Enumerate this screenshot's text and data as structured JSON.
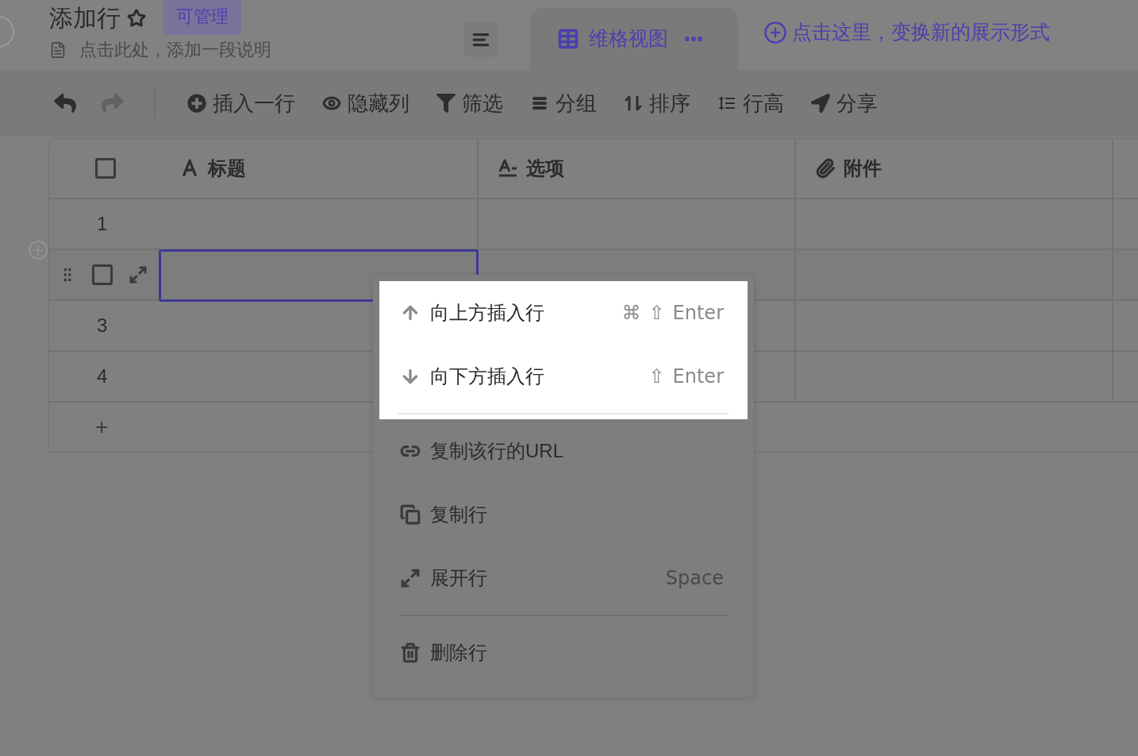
{
  "header": {
    "title": "添加行",
    "starred": false,
    "badge": "可管理",
    "description": "点击此处，添加一段说明"
  },
  "view_tabs": [
    {
      "label": "维格视图",
      "selected": true
    }
  ],
  "add_view_link": "点击这里，变换新的展示形式",
  "toolbar": {
    "undo_disabled": false,
    "redo_disabled": true,
    "buttons": [
      {
        "kind": "insert",
        "label": "插入一行"
      },
      {
        "kind": "hide",
        "label": "隐藏列"
      },
      {
        "kind": "filter",
        "label": "筛选"
      },
      {
        "kind": "group",
        "label": "分组"
      },
      {
        "kind": "sort",
        "label": "排序"
      },
      {
        "kind": "row_height",
        "label": "行高"
      },
      {
        "kind": "share",
        "label": "分享"
      }
    ]
  },
  "table": {
    "header_checked": false,
    "columns": [
      {
        "kind": "text",
        "name": "标题"
      },
      {
        "kind": "option",
        "name": "选项"
      },
      {
        "kind": "attachment",
        "name": "附件"
      }
    ],
    "rows": [
      {
        "number": "1",
        "hovered": false,
        "editing": false
      },
      {
        "hovered": true,
        "editing": true,
        "checked": false
      },
      {
        "number": "3",
        "hovered": false,
        "editing": false
      },
      {
        "number": "4",
        "hovered": false,
        "editing": false
      }
    ],
    "add_row": "+"
  },
  "context_menu": {
    "items": [
      {
        "kind": "insert_above",
        "label": "向上方插入行",
        "shortcut": [
          "⌘",
          "⇧",
          "Enter"
        ],
        "highlighted": true
      },
      {
        "kind": "insert_below",
        "label": "向下方插入行",
        "shortcut": [
          "⇧",
          "Enter"
        ],
        "highlighted": true
      },
      {
        "kind": "divider",
        "highlighted": true
      },
      {
        "kind": "copy_url",
        "label": "复制该行的URL",
        "highlighted": false
      },
      {
        "kind": "duplicate",
        "label": "复制行",
        "highlighted": false
      },
      {
        "kind": "expand",
        "label": "展开行",
        "shortcut": [
          "Space"
        ],
        "highlighted": false
      },
      {
        "kind": "divider",
        "highlighted": false
      },
      {
        "kind": "delete",
        "label": "删除行",
        "highlighted": false
      }
    ]
  }
}
